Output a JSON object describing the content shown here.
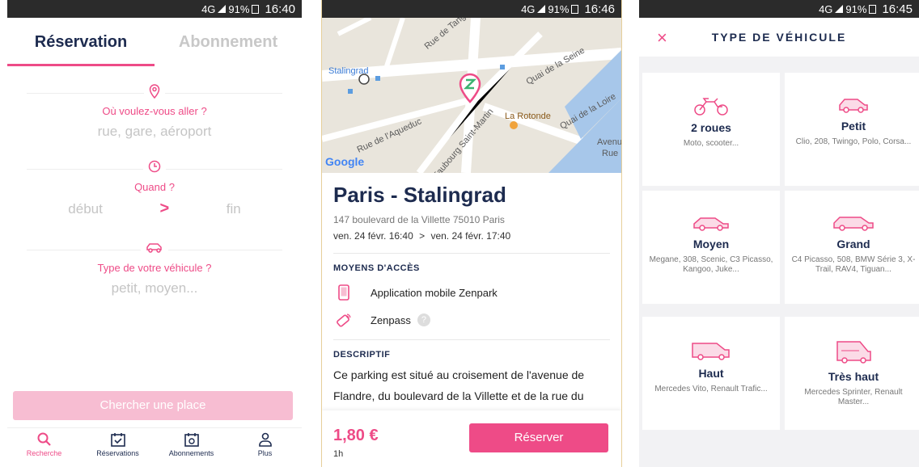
{
  "status": {
    "s1": {
      "network": "4G",
      "battery": "91%",
      "time": "16:40"
    },
    "s2": {
      "network": "4G",
      "battery": "91%",
      "time": "16:46"
    },
    "s3": {
      "network": "4G",
      "battery": "91%",
      "time": "16:45"
    }
  },
  "search": {
    "tabs": [
      {
        "label": "Réservation",
        "active": true
      },
      {
        "label": "Abonnement",
        "active": false
      }
    ],
    "where_label": "Où voulez-vous aller ?",
    "where_placeholder": "rue, gare, aéroport",
    "when_label": "Quand ?",
    "start_placeholder": "début",
    "end_placeholder": "fin",
    "arrow": ">",
    "vehicle_label": "Type de votre véhicule ?",
    "vehicle_placeholder": "petit, moyen...",
    "search_button": "Chercher une place",
    "nav": [
      {
        "label": "Recherche",
        "icon": "search-icon"
      },
      {
        "label": "Réservations",
        "icon": "calendar-check-icon"
      },
      {
        "label": "Abonnements",
        "icon": "calendar-repeat-icon"
      },
      {
        "label": "Plus",
        "icon": "user-icon"
      }
    ]
  },
  "detail": {
    "map": {
      "labels": [
        "Rue de Tanger",
        "Quai de la Seine",
        "Stalingrad",
        "Rue de l'Aqueduc",
        "Faubourg Saint-Martin",
        "La Rotonde",
        "Quai de la Loire",
        "Avenue",
        "Rue"
      ],
      "logo": "Google"
    },
    "title": "Paris - Stalingrad",
    "address": "147 boulevard de la Villette 75010 Paris",
    "start": "ven. 24 févr. 16:40",
    "end": "ven. 24 févr. 17:40",
    "separator": ">",
    "access_heading": "MOYENS D'ACCÈS",
    "access": [
      {
        "label": "Application mobile Zenpark",
        "icon": "phone-icon"
      },
      {
        "label": "Zenpass",
        "icon": "zenpass-icon"
      }
    ],
    "description_heading": "DESCRIPTIF",
    "description": "Ce parking est situé au croisement de l'avenue de Flandre, du boulevard de la Villette et de la rue du",
    "price": "1,80 €",
    "duration": "1h",
    "book_button": "Réserver",
    "info_glyph": "?"
  },
  "vehicle": {
    "title": "TYPE DE VÉHICULE",
    "close_glyph": "×",
    "types": [
      {
        "name": "2 roues",
        "examples": "Moto, scooter...",
        "icon": "motorcycle-icon"
      },
      {
        "name": "Petit",
        "examples": "Clio, 208, Twingo, Polo, Corsa...",
        "icon": "small-car-icon"
      },
      {
        "name": "Moyen",
        "examples": "Megane, 308, Scenic, C3 Picasso, Kangoo, Juke...",
        "icon": "medium-car-icon"
      },
      {
        "name": "Grand",
        "examples": "C4 Picasso, 508, BMW Série 3, X-Trail, RAV4, Tiguan...",
        "icon": "large-car-icon"
      },
      {
        "name": "Haut",
        "examples": "Mercedes Vito, Renault Trafic...",
        "icon": "van-icon"
      },
      {
        "name": "Très haut",
        "examples": "Mercedes Sprinter, Renault Master...",
        "icon": "high-van-icon"
      }
    ]
  },
  "colors": {
    "accent": "#ee4b87",
    "accent_light": "#f7bdd2",
    "navy": "#1d2b4f"
  }
}
